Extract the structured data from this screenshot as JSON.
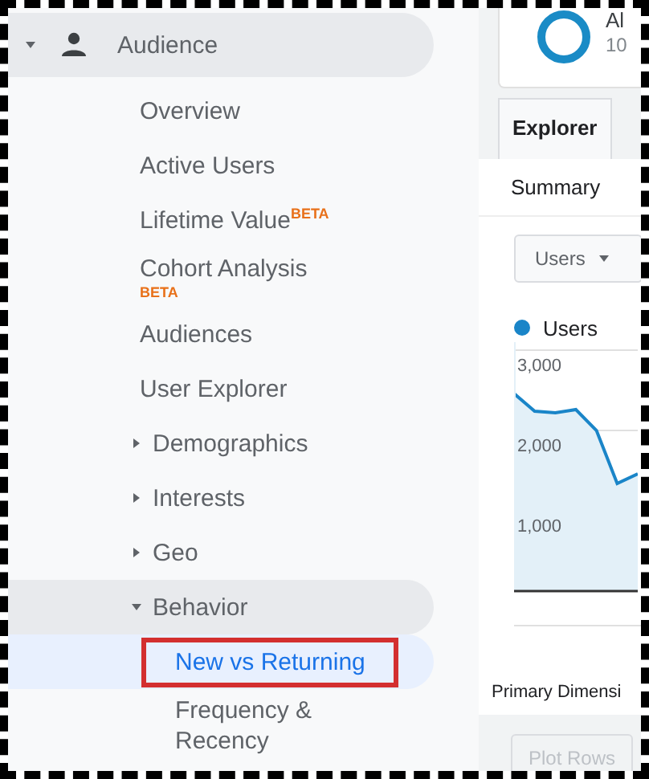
{
  "sidebar": {
    "items": [
      {
        "label": "Audience",
        "kind": "header",
        "expanded": true,
        "selected": false,
        "outlined": false,
        "children": [
          {
            "label": "Overview",
            "kind": "item",
            "selected": false,
            "outlined": false
          },
          {
            "label": "Active Users",
            "kind": "item",
            "selected": false,
            "outlined": false
          },
          {
            "label": "Lifetime Value",
            "kind": "item",
            "selected": false,
            "outlined": false,
            "badge": "BETA",
            "badge_below": false
          },
          {
            "label": "Cohort Analysis",
            "kind": "item",
            "selected": false,
            "outlined": false,
            "badge": "BETA",
            "badge_below": true
          },
          {
            "label": "Audiences",
            "kind": "item",
            "selected": false,
            "outlined": false
          },
          {
            "label": "User Explorer",
            "kind": "item",
            "selected": false,
            "outlined": false
          },
          {
            "label": "Demographics",
            "kind": "group",
            "expanded": false,
            "selected": false,
            "outlined": false
          },
          {
            "label": "Interests",
            "kind": "group",
            "expanded": false,
            "selected": false,
            "outlined": false
          },
          {
            "label": "Geo",
            "kind": "group",
            "expanded": false,
            "selected": false,
            "outlined": false
          },
          {
            "label": "Behavior",
            "kind": "group",
            "expanded": true,
            "selected": false,
            "outlined": false,
            "children": [
              {
                "label": "New vs Returning",
                "kind": "item",
                "selected": true,
                "outlined": true
              },
              {
                "label": "Frequency & Recency",
                "kind": "item",
                "selected": false,
                "outlined": false
              }
            ]
          }
        ]
      }
    ]
  },
  "summary_card": {
    "title": "Al",
    "subtitle": "10"
  },
  "tabs": [
    {
      "label": "Explorer",
      "selected": true
    }
  ],
  "subtabs": [
    {
      "label": "Summary"
    }
  ],
  "metric_dropdown": {
    "label": "Users"
  },
  "chart_data": {
    "type": "area",
    "series": [
      {
        "name": "Users",
        "color": "#1a85c8",
        "values": [
          2460,
          2240,
          2220,
          2260,
          2000,
          1340,
          1460
        ]
      }
    ],
    "ylim": [
      0,
      3100
    ],
    "yticks": [
      {
        "value": 1000,
        "label": "1,000"
      },
      {
        "value": 2000,
        "label": "2,000"
      },
      {
        "value": 3000,
        "label": "3,000"
      }
    ]
  },
  "primary_dimension": "Primary Dimensi",
  "plot_rows_button": {
    "label": "Plot Rows",
    "disabled": true
  }
}
